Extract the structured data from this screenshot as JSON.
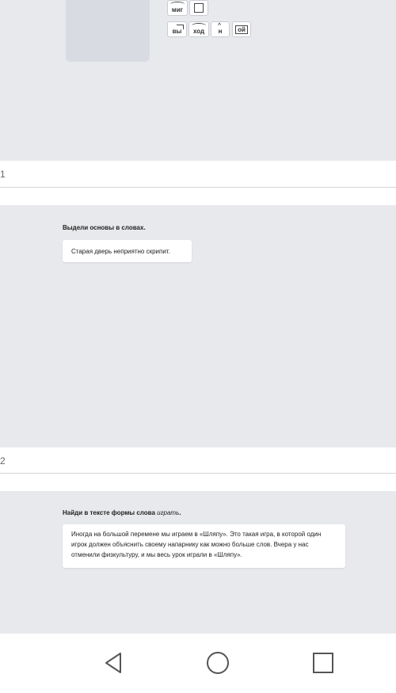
{
  "top_panel": {
    "tokens_row1": [
      "миг",
      ""
    ],
    "tokens_row2": [
      "вы",
      "ход",
      "н",
      "ой"
    ]
  },
  "pages": [
    "1",
    "2"
  ],
  "task2": {
    "title": "Выдели основы в словах.",
    "sentence": "Старая дверь неприятно скрипит."
  },
  "task3": {
    "title_prefix": "Найди в тексте формы слова ",
    "title_word": "играть",
    "title_suffix": ".",
    "text": "Иногда на большой перемене мы играем в «Шляпу». Это такая игра, в которой один игрок должен объяснить своему напарнику как можно больше слов. Вчера у нас отменили физкультуру, и мы весь урок играли в «Шляпу»."
  },
  "navbar": {
    "icons": [
      "back-icon",
      "home-icon",
      "recents-icon"
    ]
  },
  "colors": {
    "panel_bg": "#e8e9ec",
    "image_placeholder": "#d8dbe2",
    "nav_icon": "#555555"
  }
}
